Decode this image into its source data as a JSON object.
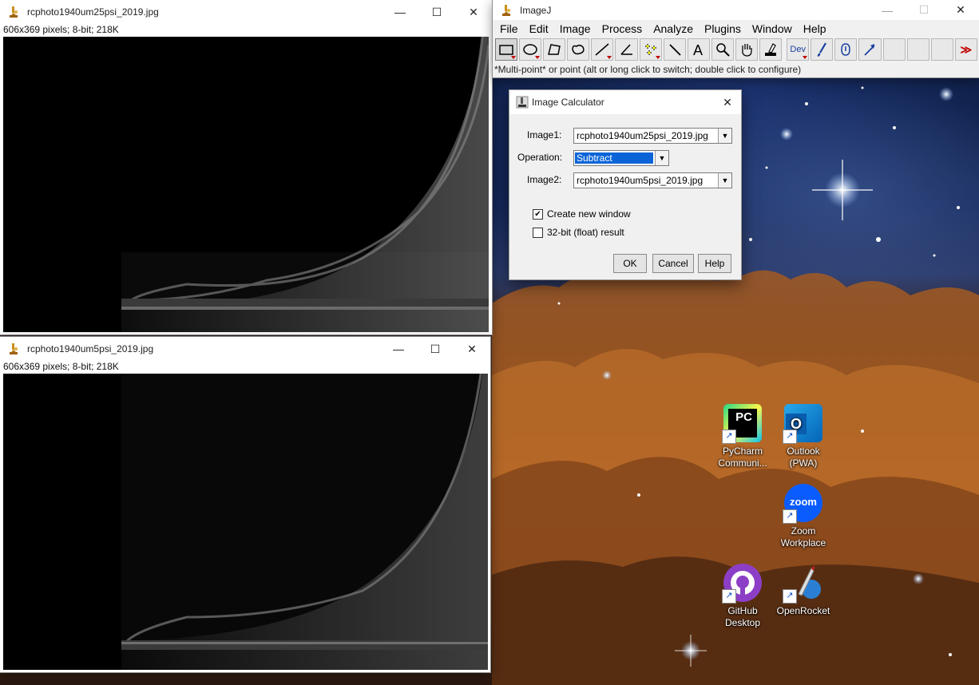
{
  "window1": {
    "title": "rcphoto1940um25psi_2019.jpg",
    "info": "606x369 pixels; 8-bit; 218K"
  },
  "window2": {
    "title": "rcphoto1940um5psi_2019.jpg",
    "info": "606x369 pixels; 8-bit; 218K"
  },
  "imagej": {
    "title": "ImageJ",
    "menu": [
      "File",
      "Edit",
      "Image",
      "Process",
      "Analyze",
      "Plugins",
      "Window",
      "Help"
    ],
    "tools": [
      {
        "name": "rectangle-tool-icon",
        "selected": true
      },
      {
        "name": "oval-tool-icon"
      },
      {
        "name": "polygon-tool-icon"
      },
      {
        "name": "freehand-tool-icon"
      },
      {
        "name": "line-tool-icon"
      },
      {
        "name": "angle-tool-icon"
      },
      {
        "name": "multipoint-tool-icon"
      },
      {
        "name": "wand-tool-icon"
      },
      {
        "name": "text-tool-icon"
      },
      {
        "name": "magnifier-tool-icon"
      },
      {
        "name": "hand-tool-icon"
      },
      {
        "name": "color-picker-tool-icon"
      },
      {
        "name": "dev-menu-tool-icon",
        "label": "Dev"
      },
      {
        "name": "brush-tool-icon"
      },
      {
        "name": "flood-fill-tool-icon"
      },
      {
        "name": "arrow-tool-icon"
      }
    ],
    "more_tools_glyph": "≫",
    "status": "*Multi-point* or point (alt or long click to switch; double click to configure)"
  },
  "dialog": {
    "title": "Image Calculator",
    "image1_label": "Image1:",
    "image1_value": "rcphoto1940um25psi_2019.jpg",
    "operation_label": "Operation:",
    "operation_value": "Subtract",
    "image2_label": "Image2:",
    "image2_value": "rcphoto1940um5psi_2019.jpg",
    "create_new_window": {
      "label": "Create new window",
      "checked": true
    },
    "float_result": {
      "label": "32-bit (float) result",
      "checked": false
    },
    "ok": "OK",
    "cancel": "Cancel",
    "help": "Help"
  },
  "desktop_icons": [
    {
      "name": "pycharm",
      "line1": "PyCharm",
      "line2": "Communi..."
    },
    {
      "name": "outlook",
      "line1": "Outlook",
      "line2": "(PWA)"
    },
    {
      "name": "zoom",
      "line1": "Zoom",
      "line2": "Workplace"
    },
    {
      "name": "github",
      "line1": "GitHub",
      "line2": "Desktop"
    },
    {
      "name": "openrocket",
      "line1": "OpenRocket",
      "line2": ""
    }
  ],
  "glyphs": {
    "minimize": "—",
    "maximize": "☐",
    "close": "✕",
    "check": "✔",
    "arrow": "▼"
  },
  "colors": {
    "accent": "#0078d7",
    "selection": "#0a64d8",
    "red_marker": "#c00000"
  }
}
